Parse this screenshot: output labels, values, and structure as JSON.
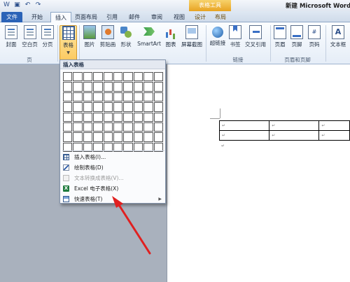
{
  "window": {
    "title": "新建 Microsoft Word 文",
    "context_group": "表格工具"
  },
  "tabs": [
    {
      "label": "文件"
    },
    {
      "label": "开始"
    },
    {
      "label": "插入"
    },
    {
      "label": "页面布局"
    },
    {
      "label": "引用"
    },
    {
      "label": "邮件"
    },
    {
      "label": "审阅"
    },
    {
      "label": "视图"
    },
    {
      "label": "设计"
    },
    {
      "label": "布局"
    }
  ],
  "ribbon": {
    "buttons": [
      {
        "label": "封面"
      },
      {
        "label": "空白页"
      },
      {
        "label": "分页"
      },
      {
        "label": "表格"
      },
      {
        "label": "图片"
      },
      {
        "label": "剪贴画"
      },
      {
        "label": "形状"
      },
      {
        "label": "SmartArt"
      },
      {
        "label": "图表"
      },
      {
        "label": "屏幕截图"
      },
      {
        "label": "超链接"
      },
      {
        "label": "书签"
      },
      {
        "label": "交叉引用"
      },
      {
        "label": "页眉"
      },
      {
        "label": "页脚"
      },
      {
        "label": "页码"
      },
      {
        "label": "文本框"
      }
    ],
    "groups": [
      {
        "label": "页"
      },
      {
        "label": "链接"
      },
      {
        "label": "页眉和页脚"
      }
    ],
    "page_number_glyph": "#",
    "textbox_glyph": "A"
  },
  "dropdown": {
    "header": "插入表格",
    "grid_rows": 8,
    "grid_cols": 10,
    "items": [
      {
        "label": "插入表格(I)...",
        "icon": "insert-table-icon",
        "enabled": true
      },
      {
        "label": "绘制表格(D)",
        "icon": "draw-table-icon",
        "enabled": true
      },
      {
        "label": "文本转换成表格(V)...",
        "icon": "convert-text-icon",
        "enabled": false
      },
      {
        "label": "Excel 电子表格(X)",
        "icon": "excel-icon",
        "enabled": true
      },
      {
        "label": "快速表格(T)",
        "icon": "quick-table-icon",
        "enabled": true,
        "submenu": true
      }
    ],
    "submenu_glyph": "▶"
  },
  "document": {
    "cell_mark": "↵",
    "paragraph_mark": "↵"
  },
  "colors": {
    "accent": "#2b63b7",
    "selected": "#fbc85d",
    "arrow": "#e02020",
    "context_tab": "#e8a322"
  }
}
